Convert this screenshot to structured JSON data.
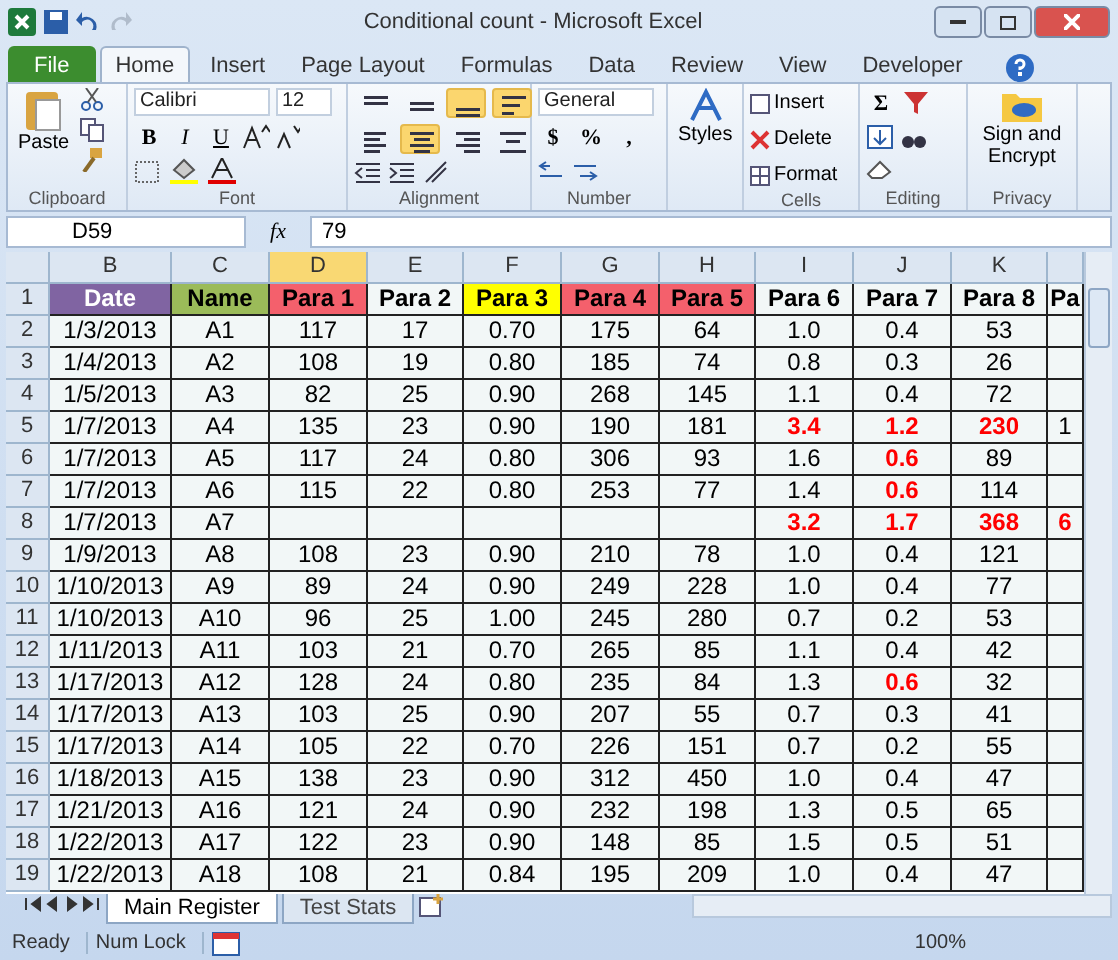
{
  "title_bar": {
    "title": "Conditional count - Microsoft Excel"
  },
  "ribbon_tabs": [
    {
      "label": "File",
      "kind": "file",
      "selected": false
    },
    {
      "label": "Home",
      "kind": "tab",
      "selected": true
    },
    {
      "label": "Insert",
      "kind": "tab",
      "selected": false
    },
    {
      "label": "Page Layout",
      "kind": "tab",
      "selected": false
    },
    {
      "label": "Formulas",
      "kind": "tab",
      "selected": false
    },
    {
      "label": "Data",
      "kind": "tab",
      "selected": false
    },
    {
      "label": "Review",
      "kind": "tab",
      "selected": false
    },
    {
      "label": "View",
      "kind": "tab",
      "selected": false
    },
    {
      "label": "Developer",
      "kind": "tab",
      "selected": false
    }
  ],
  "ribbon": {
    "clipboard": {
      "paste": "Paste",
      "label": "Clipboard"
    },
    "font": {
      "name": "Calibri",
      "size": "12",
      "bold": "B",
      "italic": "I",
      "underline": "U",
      "label": "Font"
    },
    "alignment": {
      "label": "Alignment",
      "buttons": [
        {
          "kind": "top",
          "selected": false
        },
        {
          "kind": "middle",
          "selected": false
        },
        {
          "kind": "bottom",
          "selected": true
        },
        {
          "kind": "wrap",
          "selected": true
        },
        {
          "kind": "left",
          "selected": false
        },
        {
          "kind": "center",
          "selected": true
        },
        {
          "kind": "right",
          "selected": false
        },
        {
          "kind": "merge",
          "selected": false
        }
      ]
    },
    "number": {
      "format": "General",
      "currency": "$",
      "percent": "%",
      "comma": ",",
      "label": "Number"
    },
    "styles": {
      "button": "Styles"
    },
    "cells": {
      "insert": "Insert",
      "delete": "Delete",
      "format": "Format",
      "label": "Cells"
    },
    "editing": {
      "sum": "Σ",
      "label": "Editing"
    },
    "privacy": {
      "button": "Sign and Encrypt",
      "label": "Privacy"
    }
  },
  "formula_bar": {
    "name_box": "D59",
    "function_label": "fx",
    "value": "79"
  },
  "sheet": {
    "columns": [
      {
        "letter": "B",
        "selected": false
      },
      {
        "letter": "C",
        "selected": false
      },
      {
        "letter": "D",
        "selected": true
      },
      {
        "letter": "E",
        "selected": false
      },
      {
        "letter": "F",
        "selected": false
      },
      {
        "letter": "G",
        "selected": false
      },
      {
        "letter": "H",
        "selected": false
      },
      {
        "letter": "I",
        "selected": false
      },
      {
        "letter": "J",
        "selected": false
      },
      {
        "letter": "K",
        "selected": false
      }
    ],
    "header_row": {
      "num": "1",
      "cells": [
        {
          "label": "Date",
          "color": "#8064a2"
        },
        {
          "label": "Name",
          "color": "#9bbb59"
        },
        {
          "label": "Para 1",
          "color": "#f4606c"
        },
        {
          "label": "Para 2",
          "color": "#f2f7f7"
        },
        {
          "label": "Para 3",
          "color": "#ffff00"
        },
        {
          "label": "Para 4",
          "color": "#f4606c"
        },
        {
          "label": "Para 5",
          "color": "#f4606c"
        },
        {
          "label": "Para 6",
          "color": "#f2f7f7"
        },
        {
          "label": "Para 7",
          "color": "#f2f7f7"
        },
        {
          "label": "Para 8",
          "color": "#f2f7f7"
        },
        {
          "label": "Pa",
          "color": "#f2f7f7"
        }
      ]
    },
    "rows": [
      {
        "num": "2",
        "cells": [
          "1/3/2013",
          "A1",
          "117",
          "17",
          "0.70",
          "175",
          "64",
          "1.0",
          "0.4",
          "53"
        ]
      },
      {
        "num": "3",
        "cells": [
          "1/4/2013",
          "A2",
          "108",
          "19",
          "0.80",
          "185",
          "74",
          "0.8",
          "0.3",
          "26"
        ]
      },
      {
        "num": "4",
        "cells": [
          "1/5/2013",
          "A3",
          "82",
          "25",
          "0.90",
          "268",
          "145",
          "1.1",
          "0.4",
          "72"
        ]
      },
      {
        "num": "5",
        "cells": [
          "1/7/2013",
          "A4",
          "135",
          "23",
          "0.90",
          "190",
          "181",
          {
            "text": "3.4",
            "alert": true
          },
          {
            "text": "1.2",
            "alert": true
          },
          {
            "text": "230",
            "alert": true
          },
          "1"
        ]
      },
      {
        "num": "6",
        "cells": [
          "1/7/2013",
          "A5",
          "117",
          "24",
          "0.80",
          "306",
          "93",
          "1.6",
          {
            "text": "0.6",
            "alert": true
          },
          "89"
        ]
      },
      {
        "num": "7",
        "cells": [
          "1/7/2013",
          "A6",
          "115",
          "22",
          "0.80",
          "253",
          "77",
          "1.4",
          {
            "text": "0.6",
            "alert": true
          },
          "114"
        ]
      },
      {
        "num": "8",
        "cells": [
          "1/7/2013",
          "A7",
          null,
          null,
          null,
          null,
          null,
          {
            "text": "3.2",
            "alert": true
          },
          {
            "text": "1.7",
            "alert": true
          },
          {
            "text": "368",
            "alert": true
          },
          {
            "text": "6",
            "alert": true
          }
        ]
      },
      {
        "num": "9",
        "cells": [
          "1/9/2013",
          "A8",
          "108",
          "23",
          "0.90",
          "210",
          "78",
          "1.0",
          "0.4",
          "121"
        ]
      },
      {
        "num": "10",
        "cells": [
          "1/10/2013",
          "A9",
          "89",
          "24",
          "0.90",
          "249",
          "228",
          "1.0",
          "0.4",
          "77"
        ]
      },
      {
        "num": "11",
        "cells": [
          "1/10/2013",
          "A10",
          "96",
          "25",
          "1.00",
          "245",
          "280",
          "0.7",
          "0.2",
          "53"
        ]
      },
      {
        "num": "12",
        "cells": [
          "1/11/2013",
          "A11",
          "103",
          "21",
          "0.70",
          "265",
          "85",
          "1.1",
          "0.4",
          "42"
        ]
      },
      {
        "num": "13",
        "cells": [
          "1/17/2013",
          "A12",
          "128",
          "24",
          "0.80",
          "235",
          "84",
          "1.3",
          {
            "text": "0.6",
            "alert": true
          },
          "32"
        ]
      },
      {
        "num": "14",
        "cells": [
          "1/17/2013",
          "A13",
          "103",
          "25",
          "0.90",
          "207",
          "55",
          "0.7",
          "0.3",
          "41"
        ]
      },
      {
        "num": "15",
        "cells": [
          "1/17/2013",
          "A14",
          "105",
          "22",
          "0.70",
          "226",
          "151",
          "0.7",
          "0.2",
          "55"
        ]
      },
      {
        "num": "16",
        "cells": [
          "1/18/2013",
          "A15",
          "138",
          "23",
          "0.90",
          "312",
          "450",
          "1.0",
          "0.4",
          "47"
        ]
      },
      {
        "num": "17",
        "cells": [
          "1/21/2013",
          "A16",
          "121",
          "24",
          "0.90",
          "232",
          "198",
          "1.3",
          "0.5",
          "65"
        ]
      },
      {
        "num": "18",
        "cells": [
          "1/22/2013",
          "A17",
          "122",
          "23",
          "0.90",
          "148",
          "85",
          "1.5",
          "0.5",
          "51"
        ]
      },
      {
        "num": "19",
        "cells": [
          "1/22/2013",
          "A18",
          "108",
          "21",
          "0.84",
          "195",
          "209",
          "1.0",
          "0.4",
          "47"
        ]
      }
    ]
  },
  "sheet_tabs": [
    {
      "label": "Main Register",
      "selected": true
    },
    {
      "label": "Test Stats",
      "selected": false
    }
  ],
  "status_bar": {
    "items": [
      "Ready",
      "Num Lock"
    ],
    "zoom": "100%"
  }
}
